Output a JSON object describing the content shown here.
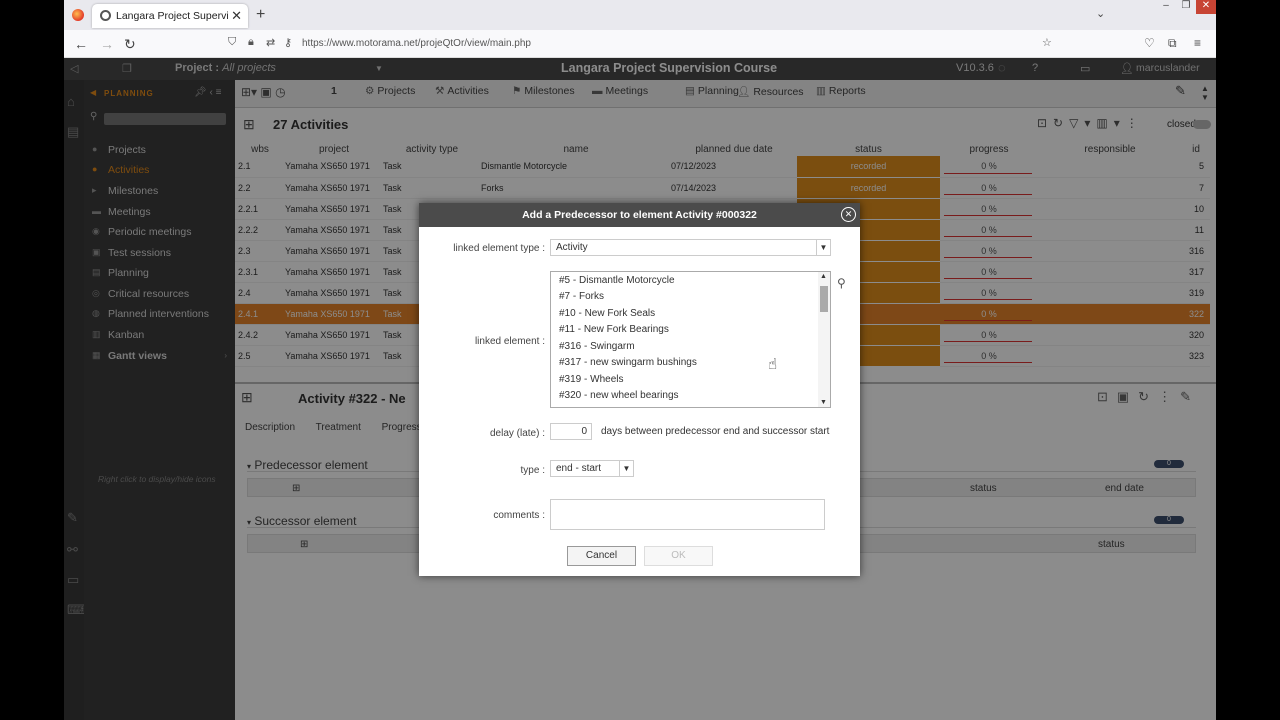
{
  "browser": {
    "tab_title": "Langara Project Supervision Co",
    "url": "https://www.motorama.net/projeQtOr/view/main.php"
  },
  "header": {
    "project_label": "Project :",
    "project_value": "All projects",
    "app_title": "Langara Project Supervision Course",
    "version": "V10.3.6",
    "user": "marcuslander"
  },
  "sidebar": {
    "title": "PLANNING",
    "items": [
      {
        "label": "Projects",
        "icon": "folder-icon"
      },
      {
        "label": "Activities",
        "icon": "activity-icon"
      },
      {
        "label": "Milestones",
        "icon": "flag-icon"
      },
      {
        "label": "Meetings",
        "icon": "meeting-icon"
      },
      {
        "label": "Periodic meetings",
        "icon": "periodic-icon"
      },
      {
        "label": "Test sessions",
        "icon": "test-icon"
      },
      {
        "label": "Planning",
        "icon": "planning-icon"
      },
      {
        "label": "Critical resources",
        "icon": "resource-icon"
      },
      {
        "label": "Planned interventions",
        "icon": "intervention-icon"
      },
      {
        "label": "Kanban",
        "icon": "kanban-icon"
      },
      {
        "label": "Gantt views",
        "icon": "gantt-icon"
      }
    ],
    "hint": "Right click to display/hide icons"
  },
  "toolbar": {
    "counter": "1",
    "buttons": [
      "Projects",
      "Activities",
      "Milestones",
      "Meetings",
      "Planning",
      "Resources",
      "Reports"
    ]
  },
  "list": {
    "title": "27 Activities",
    "closed_label": "closed",
    "columns": [
      "wbs",
      "project",
      "activity type",
      "name",
      "planned due date",
      "status",
      "progress",
      "responsible",
      "id"
    ],
    "rows": [
      [
        "2.1",
        "Yamaha XS650 1971",
        "Task",
        "Dismantle Motorcycle",
        "07/12/2023",
        "recorded",
        "0 %",
        "",
        "5"
      ],
      [
        "2.2",
        "Yamaha XS650 1971",
        "Task",
        "Forks",
        "07/14/2023",
        "recorded",
        "0 %",
        "",
        "7"
      ],
      [
        "2.2.1",
        "Yamaha XS650 1971",
        "Task",
        "",
        "",
        "",
        "0 %",
        "",
        "10"
      ],
      [
        "2.2.2",
        "Yamaha XS650 1971",
        "Task",
        "",
        "",
        "",
        "0 %",
        "",
        "11"
      ],
      [
        "2.3",
        "Yamaha XS650 1971",
        "Task",
        "",
        "",
        "",
        "0 %",
        "",
        "316"
      ],
      [
        "2.3.1",
        "Yamaha XS650 1971",
        "Task",
        "",
        "",
        "",
        "0 %",
        "",
        "317"
      ],
      [
        "2.4",
        "Yamaha XS650 1971",
        "Task",
        "",
        "",
        "",
        "0 %",
        "",
        "319"
      ],
      [
        "2.4.1",
        "Yamaha XS650 1971",
        "Task",
        "",
        "",
        "",
        "0 %",
        "",
        "322"
      ],
      [
        "2.4.2",
        "Yamaha XS650 1971",
        "Task",
        "",
        "",
        "",
        "0 %",
        "",
        "320"
      ],
      [
        "2.5",
        "Yamaha XS650 1971",
        "Task",
        "",
        "",
        "",
        "0 %",
        "",
        "323"
      ]
    ]
  },
  "detail": {
    "title": "Activity  #322  - Ne",
    "tabs": [
      "Description",
      "Treatment",
      "Progress"
    ],
    "predecessor_title": "Predecessor element",
    "predecessor_count": "0",
    "predecessor_cols": [
      "status",
      "end date"
    ],
    "successor_title": "Successor element",
    "successor_count": "0",
    "successor_cols": [
      "status"
    ]
  },
  "dialog": {
    "title": "Add a Predecessor to element Activity #000322",
    "type_label": "linked element type :",
    "type_value": "Activity",
    "element_label": "linked element :",
    "elements": [
      "#5 - Dismantle Motorcycle",
      "#7 - Forks",
      "#10 - New Fork Seals",
      "#11 - New Fork Bearings",
      "#316 - Swingarm",
      "#317 - new swingarm bushings",
      "#319 - Wheels",
      "#320 - new wheel bearings"
    ],
    "delay_label": "delay (late) :",
    "delay_value": "0",
    "delay_hint": "days between predecessor end and successor start",
    "kind_label": "type :",
    "kind_value": "end - start",
    "comments_label": "comments :",
    "cancel_label": "Cancel",
    "ok_label": "OK"
  },
  "colors": {
    "accent": "#e58b1b",
    "status_recorded": "#e08e1c",
    "dark_header": "#4a4a4a"
  }
}
